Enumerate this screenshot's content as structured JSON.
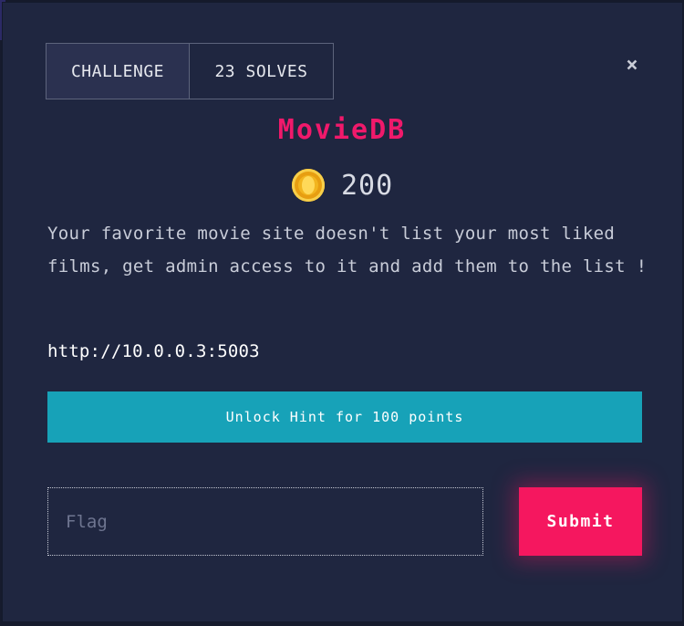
{
  "tabs": {
    "challenge_label": "CHALLENGE",
    "solves_label": "23 SOLVES"
  },
  "close_symbol": "×",
  "challenge": {
    "title": "MovieDB",
    "points": "200",
    "description": "Your favorite movie site doesn't list your most liked films, get admin access to it and add them to the list !",
    "link": "http://10.0.0.3:5003"
  },
  "hint": {
    "label": "Unlock Hint for 100 points"
  },
  "flag": {
    "placeholder": "Flag",
    "value": ""
  },
  "submit": {
    "label": "Submit"
  },
  "colors": {
    "background": "#1f2640",
    "title": "#f0196b",
    "hint_button": "#17a2b8",
    "submit_button": "#f5175f",
    "coin": "#f2b51f"
  },
  "icons": {
    "close": "close-icon",
    "coin": "coin-icon"
  }
}
